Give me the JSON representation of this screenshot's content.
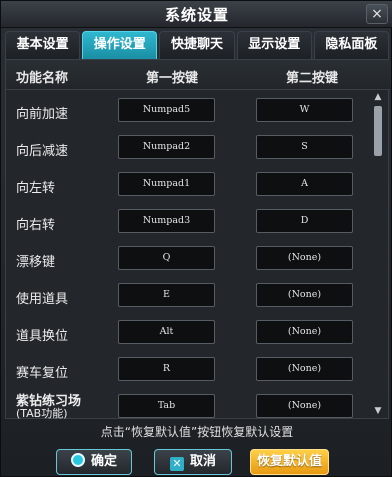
{
  "window": {
    "title": "系统设置",
    "close_label": "×"
  },
  "tabs": [
    {
      "label": "基本设置",
      "active": false
    },
    {
      "label": "操作设置",
      "active": true
    },
    {
      "label": "快捷聊天",
      "active": false
    },
    {
      "label": "显示设置",
      "active": false
    },
    {
      "label": "隐私面板",
      "active": false
    }
  ],
  "columns": {
    "name": "功能名称",
    "primary": "第一按键",
    "secondary": "第二按键"
  },
  "rows": [
    {
      "label": "向前加速",
      "key1": "Numpad5",
      "key2": "W"
    },
    {
      "label": "向后减速",
      "key1": "Numpad2",
      "key2": "S"
    },
    {
      "label": "向左转",
      "key1": "Numpad1",
      "key2": "A"
    },
    {
      "label": "向右转",
      "key1": "Numpad3",
      "key2": "D"
    },
    {
      "label": "漂移键",
      "key1": "Q",
      "key2": "(None)"
    },
    {
      "label": "使用道具",
      "key1": "E",
      "key2": "(None)"
    },
    {
      "label": "道具换位",
      "key1": "Alt",
      "key2": "(None)"
    },
    {
      "label": "赛车复位",
      "key1": "R",
      "key2": "(None)"
    },
    {
      "label": "紫钻练习场",
      "sublabel": "(TAB功能)",
      "key1": "Tab",
      "key2": "(None)"
    }
  ],
  "hint": "点击“恢复默认值”按钮恢复默认设置",
  "buttons": {
    "ok": "确定",
    "cancel": "取消",
    "restore_default": "恢复默认值"
  },
  "colors": {
    "accent": "#1fa6bd",
    "default_button": "#f2ae1e"
  },
  "icons": {
    "ok": "ok-circle-icon",
    "cancel": "x-icon",
    "scroll_up": "▲",
    "scroll_down": "▼"
  }
}
